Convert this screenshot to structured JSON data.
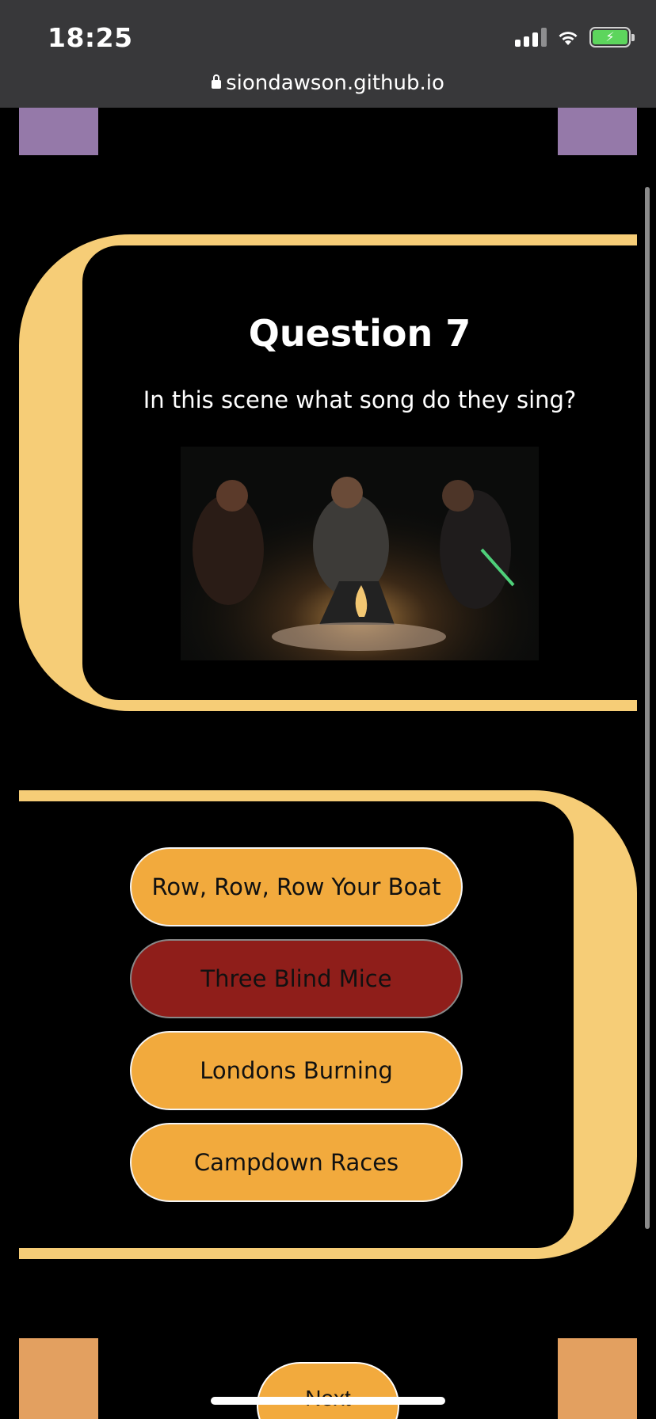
{
  "status_bar": {
    "time": "18:25",
    "url": "siondawson.github.io"
  },
  "colors": {
    "frame": "#f6cd77",
    "answer": "#f2aa3d",
    "answer_wrong": "#8f1e1a",
    "deco_top": "#9579a9",
    "deco_bottom": "#e3a060"
  },
  "question": {
    "title": "Question 7",
    "text": "In this scene what song do they sing?"
  },
  "answers": [
    {
      "label": "Row, Row, Row Your Boat",
      "state": "default"
    },
    {
      "label": "Three Blind Mice",
      "state": "wrong"
    },
    {
      "label": "Londons Burning",
      "state": "default"
    },
    {
      "label": "Campdown Races",
      "state": "default"
    }
  ],
  "next_button": {
    "label": "Next Question"
  }
}
